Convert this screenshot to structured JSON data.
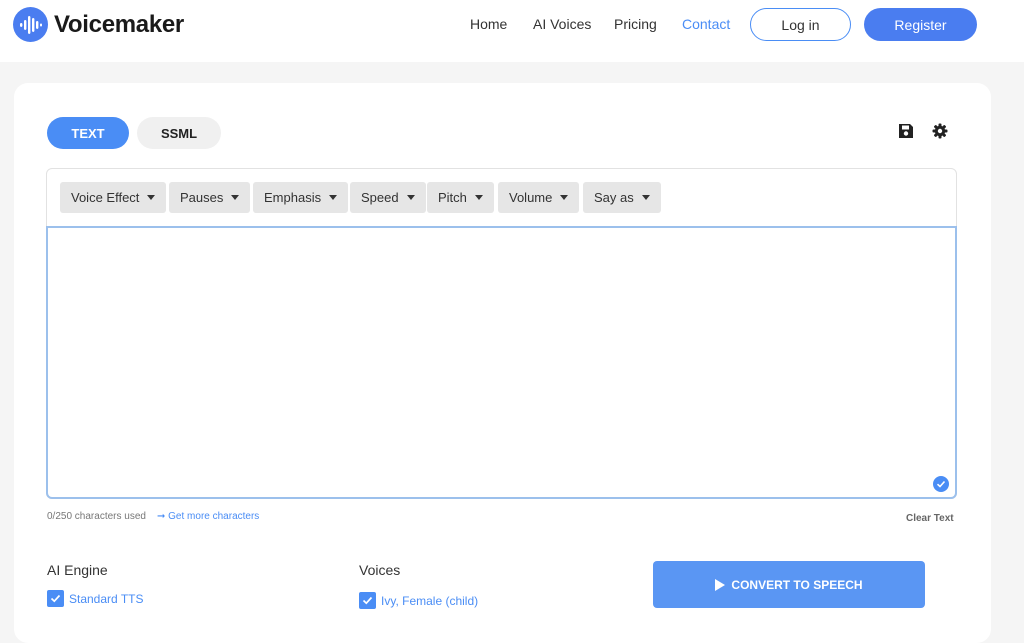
{
  "brand": {
    "name": "Voicemaker",
    "accent": "#4a7df0"
  },
  "nav": {
    "items": [
      "Home",
      "AI Voices",
      "Pricing",
      "Contact"
    ],
    "active": "Contact",
    "login_label": "Log in",
    "register_label": "Register"
  },
  "tabs": [
    "TEXT",
    "SSML"
  ],
  "active_tab": "TEXT",
  "icons": [
    "save-icon",
    "gear-icon"
  ],
  "toolbar": [
    "Voice Effect",
    "Pauses",
    "Emphasis",
    "Speed",
    "Pitch",
    "Volume",
    "Say as"
  ],
  "editor": {
    "text": ""
  },
  "meta": {
    "char_count": "0/250 characters used",
    "more_link": "➞ Get more characters",
    "clear_label": "Clear Text"
  },
  "engine": {
    "label": "AI Engine",
    "option": "Standard TTS",
    "checked": true
  },
  "voices": {
    "label": "Voices",
    "option": "Ivy, Female (child)",
    "checked": true
  },
  "convert_label": "CONVERT TO SPEECH"
}
